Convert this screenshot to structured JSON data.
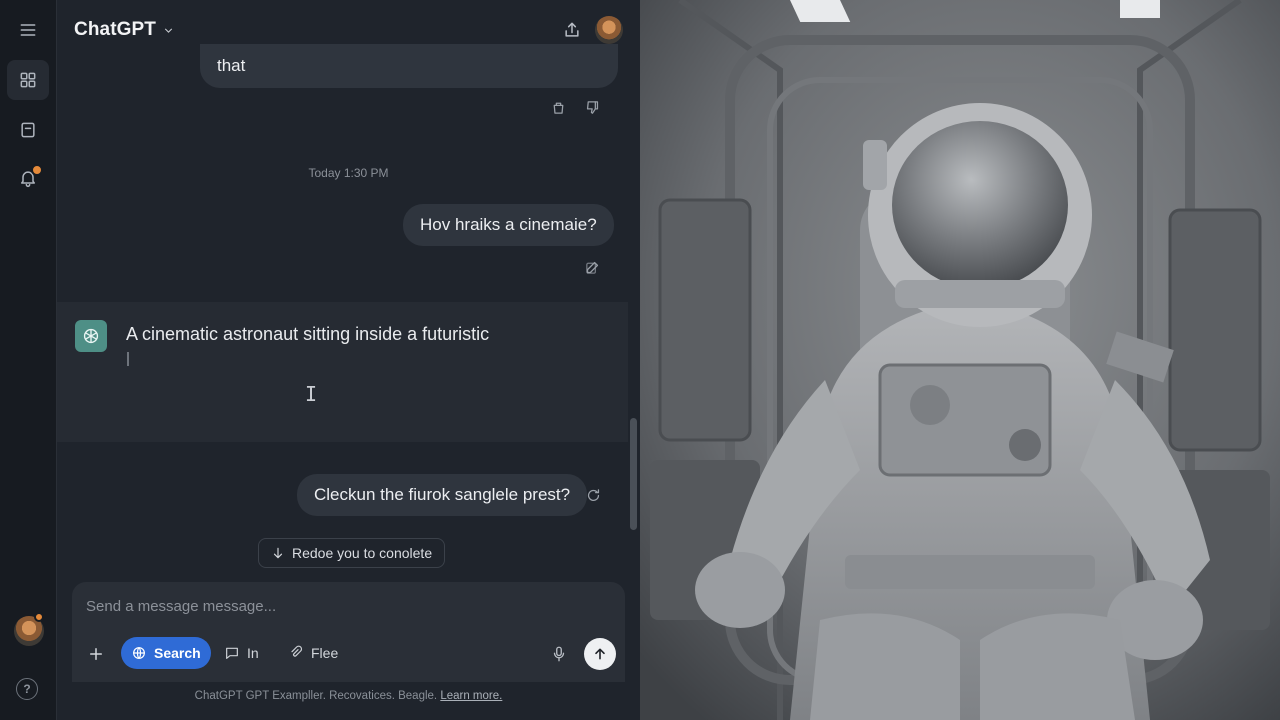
{
  "header": {
    "app_title": "ChatGPT"
  },
  "conversation": {
    "prev_message_tail": "that",
    "timestamp": "Today 1:30 PM",
    "user_message_1": "Hov hraiks a cinemaie?",
    "assistant_message": "A cinematic astronaut sitting inside a futuristic",
    "user_message_2": "Cleckun the fiurok sanglele prest?",
    "jump_label": "Redoe you to conolete"
  },
  "composer": {
    "placeholder": "Send a message message...",
    "tools": {
      "search": "Search",
      "in": "In",
      "file": "Flee"
    }
  },
  "footer": {
    "note": "ChatGPT GPT Exampller. Recovatices. Beagle.",
    "link": "Learn more."
  },
  "colors": {
    "accent": "#2f6bd6",
    "notification": "#e58a3a"
  },
  "icons": [
    "menu-icon",
    "grid-icon",
    "note-icon",
    "bell-icon",
    "chevron-down-icon",
    "share-icon",
    "copy-icon",
    "thumbs-down-icon",
    "edit-icon",
    "regenerate-icon",
    "arrow-down-icon",
    "plus-icon",
    "globe-icon",
    "chat-icon",
    "paperclip-icon",
    "mic-icon",
    "send-arrow-icon",
    "help-icon"
  ]
}
